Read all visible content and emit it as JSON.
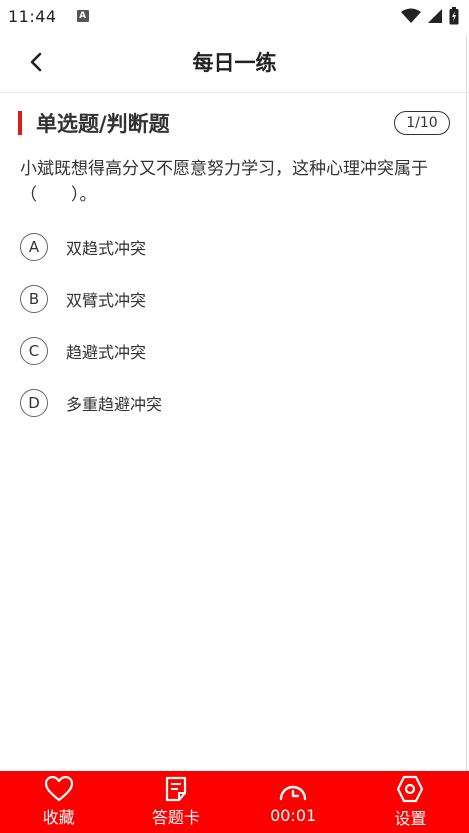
{
  "status_bar": {
    "time": "11:44",
    "notification_glyph": "A"
  },
  "header": {
    "title": "每日一练",
    "back_icon": "chevron-left-icon"
  },
  "question": {
    "type_label": "单选题/判断题",
    "progress": "1/10",
    "text": "小斌既想得高分又不愿意努力学习，这种心理冲突属于（　　）。",
    "options": [
      {
        "letter": "A",
        "text": "双趋式冲突"
      },
      {
        "letter": "B",
        "text": "双臂式冲突"
      },
      {
        "letter": "C",
        "text": "趋避式冲突"
      },
      {
        "letter": "D",
        "text": "多重趋避冲突"
      }
    ]
  },
  "bottom_bar": {
    "favorite_label": "收藏",
    "answer_card_label": "答题卡",
    "timer_label": "00:01",
    "settings_label": "设置",
    "accent_color": "#ff0000"
  },
  "colors": {
    "accent_bar": "#e01919",
    "text": "#333333"
  }
}
